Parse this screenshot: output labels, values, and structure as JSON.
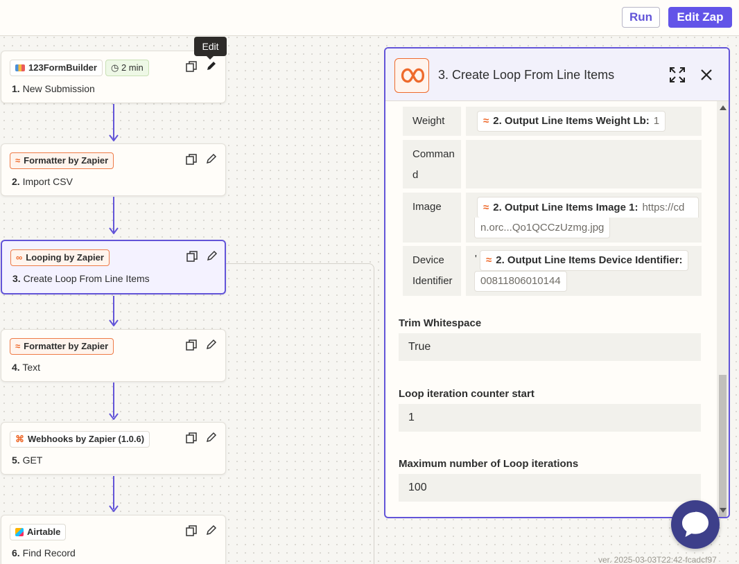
{
  "header": {
    "run_label": "Run",
    "edit_label": "Edit Zap"
  },
  "tooltip": "Edit",
  "steps": [
    {
      "app": "123FormBuilder",
      "time": "2 min",
      "number": "1.",
      "title": "New Submission"
    },
    {
      "app": "Formatter by Zapier",
      "number": "2.",
      "title": "Import CSV"
    },
    {
      "app": "Looping by Zapier",
      "number": "3.",
      "title": "Create Loop From Line Items"
    },
    {
      "app": "Formatter by Zapier",
      "number": "4.",
      "title": "Text"
    },
    {
      "app": "Webhooks by Zapier (1.0.6)",
      "number": "5.",
      "title": "GET"
    },
    {
      "app": "Airtable",
      "number": "6.",
      "title": "Find Record"
    }
  ],
  "panel": {
    "title": "3. Create Loop From Line Items",
    "mappings": [
      {
        "key": "Weight",
        "pill_label": "2. Output Line Items Weight Lb:",
        "pill_value": "1"
      },
      {
        "key": "Comman d",
        "pill_label": "",
        "pill_value": ""
      },
      {
        "key": "Image",
        "pill_label": "2. Output Line Items Image 1:",
        "pill_value": "https://cd",
        "pill_value_cont": "n.orc...Qo1QCCzUzmg.jpg"
      },
      {
        "key": "Device Identifier",
        "prefix": "'",
        "pill_label": "2. Output Line Items Device Identifier:",
        "pill_value": "00811806010144"
      }
    ],
    "fields": [
      {
        "label": "Trim Whitespace",
        "value": "True"
      },
      {
        "label": "Loop iteration counter start",
        "value": "1"
      },
      {
        "label": "Maximum number of Loop iterations",
        "value": "100"
      }
    ]
  },
  "version": "ver. 2025-03-03T22:42-fcadcf97",
  "colors": {
    "accent": "#6254e8",
    "orange": "#ee6a2c",
    "chat": "#3d3f8a"
  },
  "icons": [
    "formbuilder-icon",
    "timer-icon",
    "formatter-icon",
    "looping-icon",
    "webhooks-icon",
    "airtable-icon",
    "copy-icon",
    "pencil-icon",
    "expand-icon",
    "close-icon",
    "chat-icon"
  ]
}
